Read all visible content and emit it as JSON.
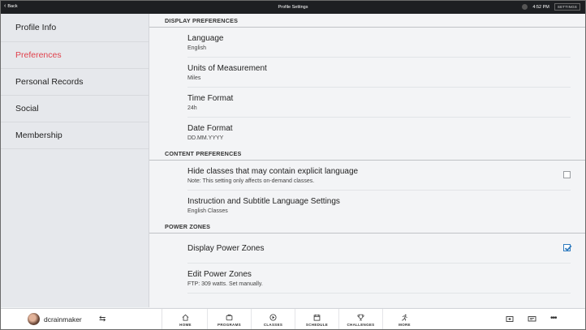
{
  "topbar": {
    "back_label": "Back",
    "title": "Profile Settings",
    "time": "4:52 PM",
    "settings_label": "SETTINGS"
  },
  "sidebar": {
    "items": [
      {
        "label": "Profile Info",
        "active": false
      },
      {
        "label": "Preferences",
        "active": true
      },
      {
        "label": "Personal Records",
        "active": false
      },
      {
        "label": "Social",
        "active": false
      },
      {
        "label": "Membership",
        "active": false
      }
    ]
  },
  "main": {
    "display_header": "DISPLAY PREFERENCES",
    "language": {
      "title": "Language",
      "value": "English"
    },
    "units": {
      "title": "Units of Measurement",
      "value": "Miles"
    },
    "time_format": {
      "title": "Time Format",
      "value": "24h"
    },
    "date_format": {
      "title": "Date Format",
      "value": "DD.MM.YYYY"
    },
    "content_header": "CONTENT PREFERENCES",
    "explicit": {
      "title": "Hide classes that may contain explicit language",
      "note": "Note: This setting only affects on-demand classes.",
      "checked": false
    },
    "subtitles": {
      "title": "Instruction and Subtitle Language Settings",
      "value": "English Classes"
    },
    "power_header": "POWER ZONES",
    "display_zones": {
      "title": "Display Power Zones",
      "checked": true
    },
    "edit_zones": {
      "title": "Edit Power Zones",
      "value": "FTP: 309 watts. Set manually."
    }
  },
  "bottombar": {
    "username": "dcrainmaker",
    "nav": [
      {
        "label": "HOME",
        "icon": "home-icon"
      },
      {
        "label": "PROGRAMS",
        "icon": "programs-icon"
      },
      {
        "label": "CLASSES",
        "icon": "classes-icon"
      },
      {
        "label": "SCHEDULE",
        "icon": "schedule-icon"
      },
      {
        "label": "CHALLENGES",
        "icon": "trophy-icon"
      },
      {
        "label": "MORE",
        "icon": "more-person-icon"
      }
    ]
  },
  "colors": {
    "accent": "#e0414c",
    "checkbox": "#2f7bbf",
    "topbar": "#1d1f22"
  }
}
